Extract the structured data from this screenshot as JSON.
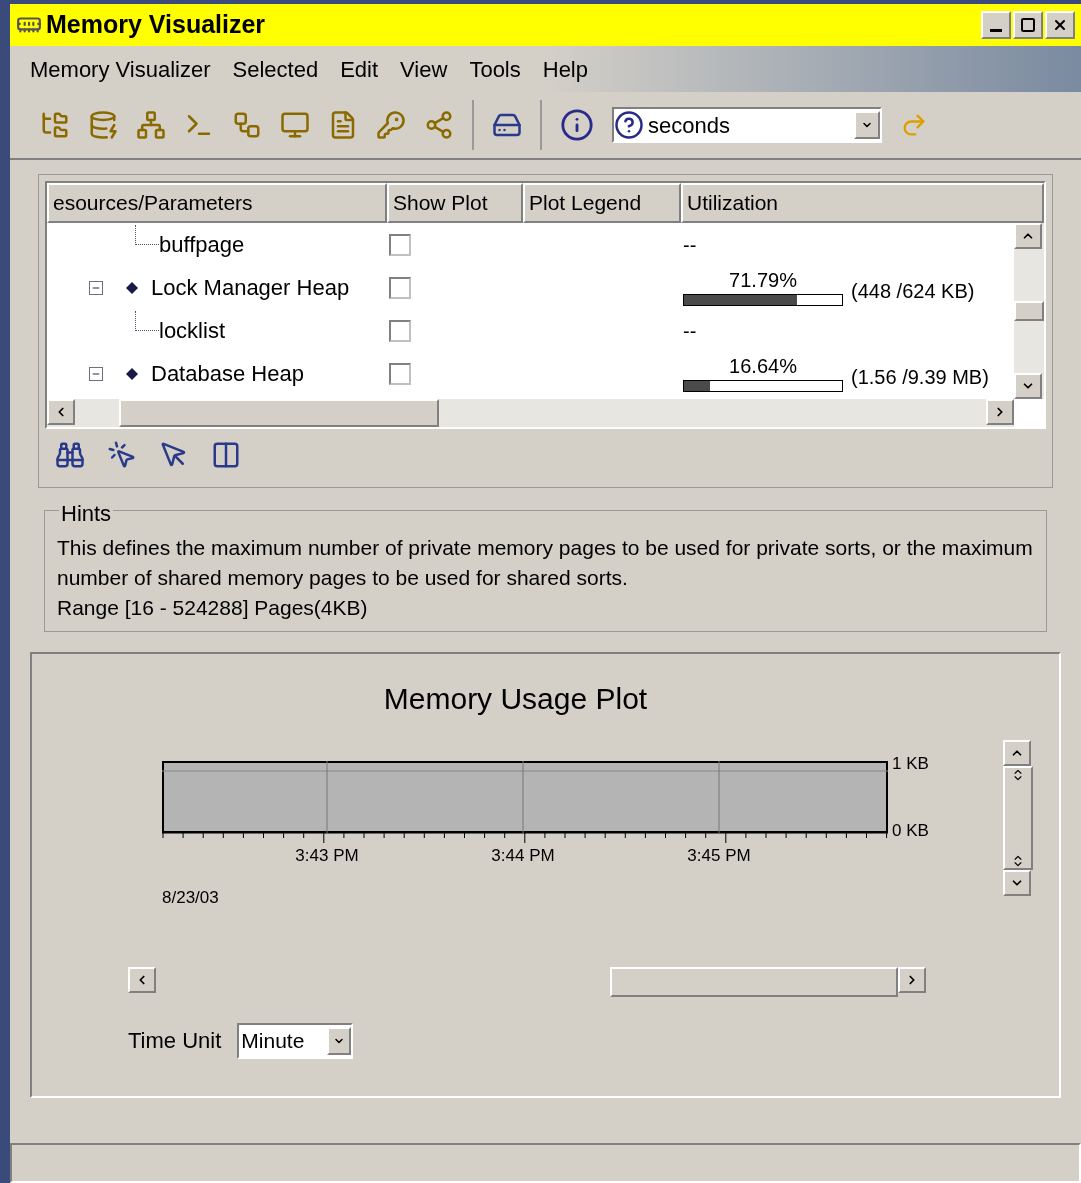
{
  "window": {
    "title": "Memory Visualizer"
  },
  "menu": [
    {
      "label": "Memory Visualizer"
    },
    {
      "label": "Selected"
    },
    {
      "label": "Edit"
    },
    {
      "label": "View"
    },
    {
      "label": "Tools"
    },
    {
      "label": "Help"
    }
  ],
  "toolbar": {
    "help_field": {
      "value": "seconds"
    }
  },
  "table": {
    "columns": [
      "esources/Parameters",
      "Show Plot",
      "Plot Legend",
      "Utilization"
    ],
    "rows": [
      {
        "kind": "parameter",
        "name": "buffpage",
        "show_plot": false,
        "utilization": "--"
      },
      {
        "kind": "heap",
        "name": "Lock Manager Heap",
        "expanded": true,
        "show_plot": false,
        "percent": "71.79%",
        "level": 0.7179,
        "reading": "(448 /624 KB)",
        "children": [
          {
            "kind": "parameter",
            "name": "locklist",
            "show_plot": false,
            "utilization": "--"
          }
        ]
      },
      {
        "kind": "heap",
        "name": "Database Heap",
        "expanded": true,
        "show_plot": false,
        "percent": "16.64%",
        "level": 0.1664,
        "reading": "(1.56 /9.39 MB)"
      }
    ]
  },
  "hints": {
    "title": "Hints",
    "text": "This defines the maximum number of private memory pages to be used for private sorts, or the maximum number of shared memory pages to be used for shared sorts.",
    "range": "Range [16 - 524288] Pages(4KB)"
  },
  "plot": {
    "title": "Memory Usage Plot",
    "y_labels": [
      "1 KB",
      "0 KB"
    ],
    "x_labels": [
      "3:43 PM",
      "3:44 PM",
      "3:45 PM"
    ],
    "date": "8/23/03",
    "time_unit": {
      "label": "Time Unit",
      "value": "Minute"
    }
  }
}
